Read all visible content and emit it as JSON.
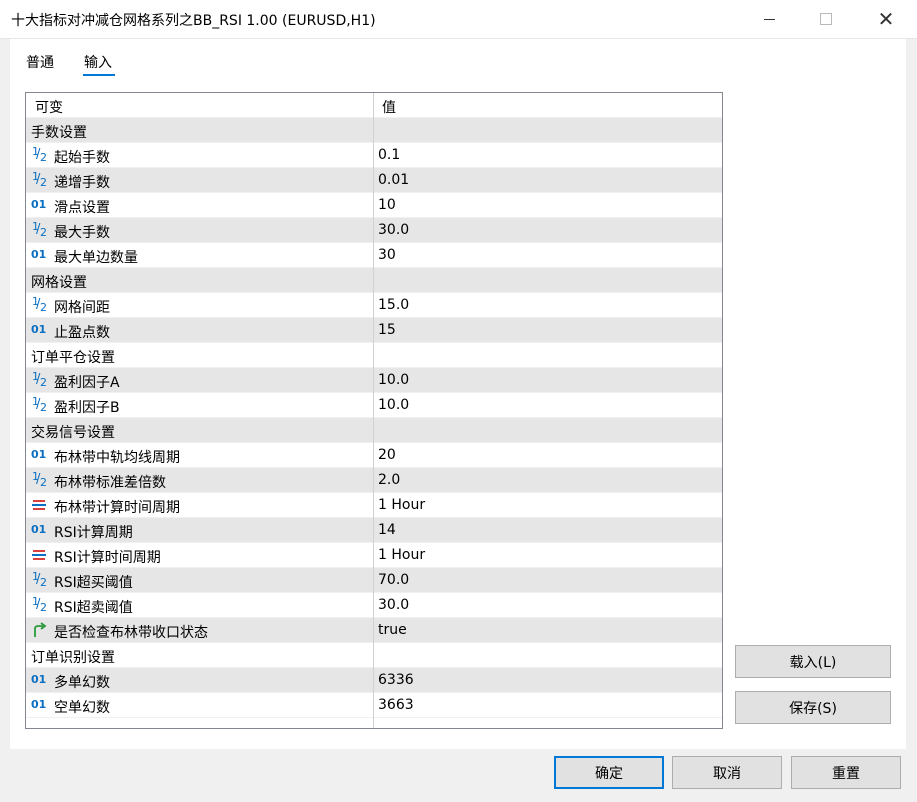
{
  "window": {
    "title": "十大指标对冲减仓网格系列之BB_RSI 1.00 (EURUSD,H1)",
    "close_glyph": "✕"
  },
  "tabs": [
    {
      "label": "普通"
    },
    {
      "label": "输入",
      "active": true
    }
  ],
  "grid": {
    "header": {
      "name": "可变",
      "value": "值"
    },
    "rows": [
      {
        "type": "section",
        "name": "手数设置"
      },
      {
        "type": "param",
        "icon": "fraction-icon",
        "name": "起始手数",
        "value": "0.1"
      },
      {
        "type": "param",
        "icon": "fraction-icon",
        "name": "递增手数",
        "value": "0.01"
      },
      {
        "type": "param",
        "icon": "integer-icon",
        "name": "滑点设置",
        "value": "10"
      },
      {
        "type": "param",
        "icon": "fraction-icon",
        "name": "最大手数",
        "value": "30.0"
      },
      {
        "type": "param",
        "icon": "integer-icon",
        "name": "最大单边数量",
        "value": "30"
      },
      {
        "type": "section",
        "name": "网格设置"
      },
      {
        "type": "param",
        "icon": "fraction-icon",
        "name": "网格间距",
        "value": "15.0"
      },
      {
        "type": "param",
        "icon": "integer-icon",
        "name": "止盈点数",
        "value": "15"
      },
      {
        "type": "section",
        "name": "订单平仓设置"
      },
      {
        "type": "param",
        "icon": "fraction-icon",
        "name": "盈利因子A",
        "value": "10.0"
      },
      {
        "type": "param",
        "icon": "fraction-icon",
        "name": "盈利因子B",
        "value": "10.0"
      },
      {
        "type": "section",
        "name": "交易信号设置"
      },
      {
        "type": "param",
        "icon": "integer-icon",
        "name": "布林带中轨均线周期",
        "value": "20"
      },
      {
        "type": "param",
        "icon": "fraction-icon",
        "name": "布林带标准差倍数",
        "value": "2.0"
      },
      {
        "type": "param",
        "icon": "enum-icon",
        "name": "布林带计算时间周期",
        "value": "1 Hour"
      },
      {
        "type": "param",
        "icon": "integer-icon",
        "name": "RSI计算周期",
        "value": "14"
      },
      {
        "type": "param",
        "icon": "enum-icon",
        "name": "RSI计算时间周期",
        "value": "1 Hour"
      },
      {
        "type": "param",
        "icon": "fraction-icon",
        "name": "RSI超买阈值",
        "value": "70.0"
      },
      {
        "type": "param",
        "icon": "fraction-icon",
        "name": "RSI超卖阈值",
        "value": "30.0"
      },
      {
        "type": "param",
        "icon": "bool-icon",
        "name": "是否检查布林带收口状态",
        "value": "true"
      },
      {
        "type": "section",
        "name": "订单识别设置"
      },
      {
        "type": "param",
        "icon": "integer-icon",
        "name": "多单幻数",
        "value": "6336"
      },
      {
        "type": "param",
        "icon": "integer-icon",
        "name": "空单幻数",
        "value": "3663"
      }
    ]
  },
  "side_buttons": {
    "load": "载入(L)",
    "save": "保存(S)"
  },
  "footer_buttons": {
    "ok": "确定",
    "cancel": "取消",
    "reset": "重置"
  },
  "colors": {
    "accent": "#0078d7",
    "row_alt": "#e6e6e6",
    "icon_blue": "#0a6fc2",
    "icon_red": "#d9403a",
    "icon_green": "#2a9a3a"
  }
}
